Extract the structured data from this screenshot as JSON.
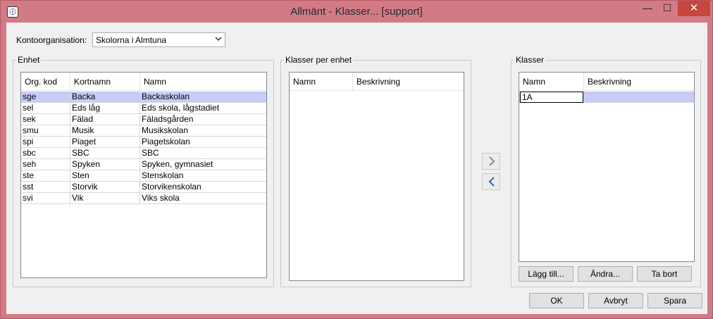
{
  "window": {
    "title": "Allmänt - Klasser... [support]",
    "app_icon_text": "\u0010",
    "minimize_glyph": "—",
    "maximize_glyph": "☐",
    "close_glyph": "✕"
  },
  "kontoorganisation": {
    "label": "Kontoorganisation:",
    "value": "Skolorna i Almtuna",
    "arrow": "⌄"
  },
  "enhet": {
    "legend": "Enhet",
    "columns": [
      "Org. kod",
      "Kortnamn",
      "Namn"
    ],
    "rows": [
      {
        "code": "sge",
        "short": "Backa",
        "name": "Backaskolan"
      },
      {
        "code": "sel",
        "short": "Eds låg",
        "name": "Eds skola, lågstadiet"
      },
      {
        "code": "sek",
        "short": "Fälad",
        "name": "Fäladsgården"
      },
      {
        "code": "smu",
        "short": "Musik",
        "name": "Musikskolan"
      },
      {
        "code": "spi",
        "short": "Piaget",
        "name": "Piagetskolan"
      },
      {
        "code": "sbc",
        "short": "SBC",
        "name": "SBC"
      },
      {
        "code": "seh",
        "short": "Spyken",
        "name": "Spyken, gymnasiet"
      },
      {
        "code": "ste",
        "short": "Sten",
        "name": "Stenskolan"
      },
      {
        "code": "sst",
        "short": "Storvik",
        "name": "Storvikenskolan"
      },
      {
        "code": "svi",
        "short": "Vik",
        "name": "Viks skola"
      }
    ]
  },
  "klasser_per_enhet": {
    "legend": "Klasser per enhet",
    "columns": [
      "Namn",
      "Beskrivning"
    ]
  },
  "klasser": {
    "legend": "Klasser",
    "columns": [
      "Namn",
      "Beskrivning"
    ],
    "rows": [
      {
        "name": "1A",
        "description": ""
      }
    ],
    "add_label": "Lägg till...",
    "edit_label": "Ändra...",
    "remove_label": "Ta bort"
  },
  "footer": {
    "ok_label": "OK",
    "cancel_label": "Avbryt",
    "save_label": "Spara"
  },
  "colors": {
    "titlebar": "#d27a86",
    "selection": "#c6ccf5",
    "close_button": "#c7463f"
  }
}
